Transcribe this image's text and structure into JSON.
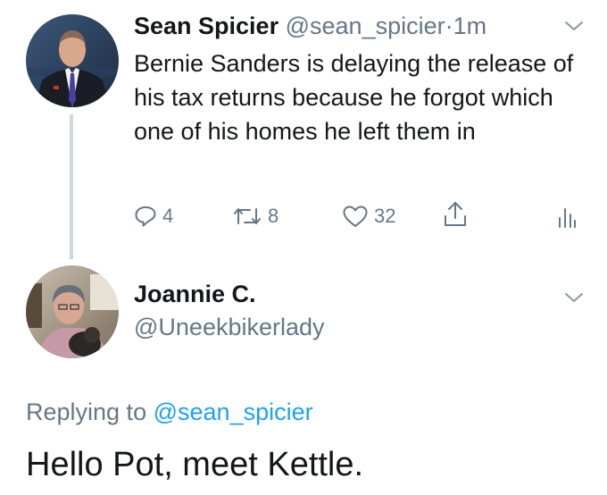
{
  "tweet1": {
    "author_name": "Sean Spicier",
    "handle": "@sean_spicier",
    "separator": "·",
    "time": "1m",
    "text": "Bernie Sanders is delaying the release of his tax returns because he forgot which one of his homes he left them in",
    "actions": {
      "reply_count": "4",
      "retweet_count": "8",
      "like_count": "32"
    }
  },
  "tweet2": {
    "author_name": "Joannie C.",
    "handle": "@Uneekbikerlady",
    "replying_prefix": "Replying to",
    "replying_to": "@sean_spicier",
    "text": "Hello Pot, meet Kettle."
  },
  "icons": {
    "reply": "reply-icon",
    "retweet": "retweet-icon",
    "like": "heart-icon",
    "share": "share-icon",
    "stats": "analytics-icon",
    "menu": "chevron-down-icon"
  },
  "colors": {
    "text": "#14171a",
    "secondary": "#657786",
    "link": "#1da1f2",
    "thread_line": "#cfd7de"
  }
}
